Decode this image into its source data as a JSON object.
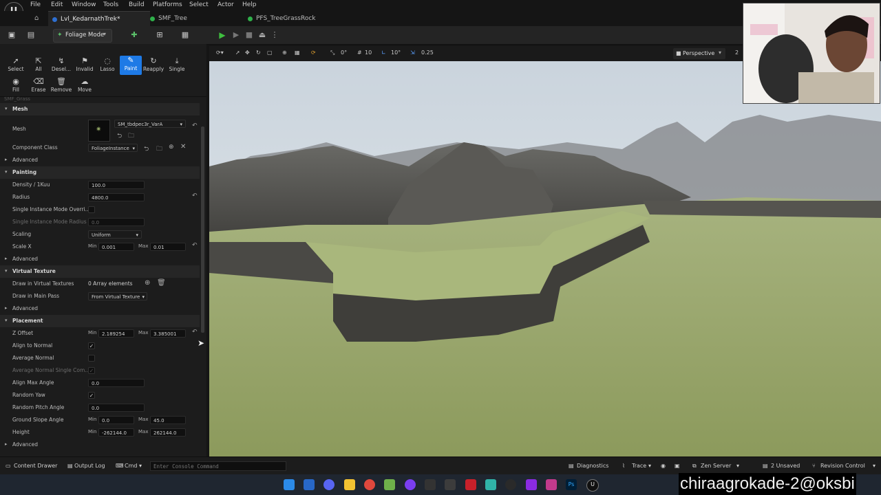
{
  "menu": [
    "File",
    "Edit",
    "Window",
    "Tools",
    "Build",
    "Platforms",
    "Select",
    "Actor",
    "Help"
  ],
  "tabs": [
    {
      "label": "Lvl_KedarnathTrek*",
      "color": "#2e6fd1",
      "active": true
    },
    {
      "label": "SMF_Tree",
      "color": "#2fb04a",
      "active": false
    },
    {
      "label": "PFS_TreeGrassRock",
      "color": "#2fb04a",
      "active": false
    }
  ],
  "toolbar": {
    "mode_label": "Foliage Mode"
  },
  "tools_row1": [
    {
      "label": "Select",
      "icon": "cursor-icon"
    },
    {
      "label": "All",
      "icon": "select-all-icon"
    },
    {
      "label": "Desel...",
      "icon": "deselect-icon"
    },
    {
      "label": "Invalid",
      "icon": "invalid-icon"
    },
    {
      "label": "Lasso",
      "icon": "lasso-icon"
    },
    {
      "label": "Paint",
      "icon": "paint-brush-icon",
      "active": true
    },
    {
      "label": "Reapply",
      "icon": "reapply-icon"
    },
    {
      "label": "Single",
      "icon": "single-icon"
    }
  ],
  "tools_row2": [
    {
      "label": "Fill",
      "icon": "fill-icon"
    },
    {
      "label": "Erase",
      "icon": "erase-icon"
    },
    {
      "label": "Remove",
      "icon": "remove-icon"
    },
    {
      "label": "Move",
      "icon": "move-icon"
    }
  ],
  "details": {
    "cut_header": "SMF_Grass",
    "mesh_section": "Mesh",
    "mesh_label": "Mesh",
    "mesh_value": "SM_tbdpec3r_VarA",
    "component_class_label": "Component Class",
    "component_class_value": "FoliageInstance",
    "advanced": "Advanced",
    "painting_section": "Painting",
    "density_label": "Density / 1Kuu",
    "density_value": "100.0",
    "radius_label": "Radius",
    "radius_value": "4800.0",
    "single_override_label": "Single Instance Mode Overri...",
    "single_radius_label": "Single Instance Mode Radius",
    "single_radius_value": "0.0",
    "scaling_label": "Scaling",
    "scaling_value": "Uniform",
    "scale_x_label": "Scale X",
    "min": "Min",
    "max": "Max",
    "scale_x_min": "0.001",
    "scale_x_max": "0.01",
    "vt_section": "Virtual Texture",
    "draw_vt_label": "Draw in Virtual Textures",
    "draw_vt_value": "0 Array elements",
    "draw_main_label": "Draw in Main Pass",
    "draw_main_value": "From Virtual Texture",
    "placement_section": "Placement",
    "z_offset_label": "Z Offset",
    "z_offset_min": "2.189254",
    "z_offset_max": "3.385001",
    "align_normal_label": "Align to Normal",
    "avg_normal_label": "Average Normal",
    "avg_normal_single_label": "Average Normal Single Com...",
    "align_max_label": "Align Max Angle",
    "align_max_value": "0.0",
    "random_yaw_label": "Random Yaw",
    "random_pitch_label": "Random Pitch Angle",
    "random_pitch_value": "0.0",
    "ground_slope_label": "Ground Slope Angle",
    "ground_slope_min": "0.0",
    "ground_slope_max": "45.0",
    "height_label": "Height",
    "height_min": "-262144.0",
    "height_max": "262144.0"
  },
  "viewport": {
    "snap_a": "0°",
    "snap_b": "10",
    "snap_c": "10°",
    "snap_d": "0.25",
    "perspective": "Perspective",
    "cam_speed": "2"
  },
  "bottombar": {
    "content_drawer": "Content Drawer",
    "output_log": "Output Log",
    "cmd": "Cmd",
    "console_placeholder": "Enter Console Command",
    "diagnostics": "Diagnostics",
    "trace": "Trace",
    "zen_server": "Zen Server",
    "unsaved": "2 Unsaved",
    "revision": "Revision Control"
  },
  "watermark": "chiraagrokade-2@oksbi",
  "colors": {
    "accent": "#1e7ae6",
    "play": "#3fbf3f"
  }
}
